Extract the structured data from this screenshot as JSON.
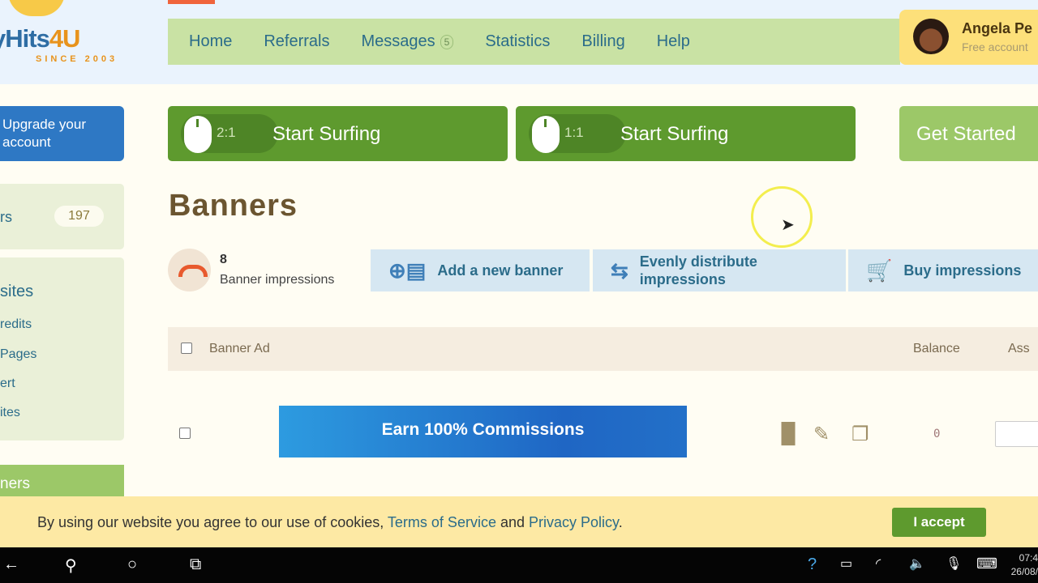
{
  "logo": {
    "text_main": "yHits",
    "text_num": "4U",
    "since": "SINCE 2003"
  },
  "nav": [
    {
      "label": "Home"
    },
    {
      "label": "Referrals"
    },
    {
      "label": "Messages",
      "badge": "5"
    },
    {
      "label": "Statistics"
    },
    {
      "label": "Billing"
    },
    {
      "label": "Help"
    }
  ],
  "user": {
    "name": "Angela Pe",
    "account_type": "Free account"
  },
  "upgrade_label": "Upgrade your account",
  "surf_buttons": [
    {
      "ratio": "2:1",
      "label": "Start Surfing"
    },
    {
      "ratio": "1:1",
      "label": "Start Surfing"
    }
  ],
  "get_started": "Get Started",
  "sidebar": {
    "counter_label": "rs",
    "counter_value": "197",
    "section_title": "sites",
    "items": [
      "redits",
      "Pages",
      "ert",
      "ites"
    ],
    "active_item": "ners"
  },
  "page_title": "Banners",
  "stats": {
    "value": "8",
    "label": "Banner impressions"
  },
  "actions": [
    {
      "label": "Add a new banner",
      "icon": "add-banner-icon"
    },
    {
      "label": "Evenly distribute impressions",
      "icon": "distribute-icon"
    },
    {
      "label": "Buy impressions",
      "icon": "cart-icon"
    }
  ],
  "table": {
    "headers": {
      "banner": "Banner Ad",
      "balance": "Balance",
      "assign": "Ass"
    },
    "rows": [
      {
        "banner_text": "Earn 100% Commissions",
        "balance": "0"
      }
    ]
  },
  "cookie": {
    "prefix": "By using our website you agree to our use of cookies, ",
    "tos": "Terms of Service",
    "and": " and ",
    "privacy": "Privacy Policy",
    "suffix": ".",
    "accept": "I accept"
  },
  "taskbar": {
    "time": "07:4",
    "date": "26/08/"
  },
  "colors": {
    "nav_bg": "#c9e2a4",
    "surf_green": "#5e9a2e",
    "upgrade_blue": "#2e78c4",
    "cookie_bg": "#fde9a4"
  }
}
